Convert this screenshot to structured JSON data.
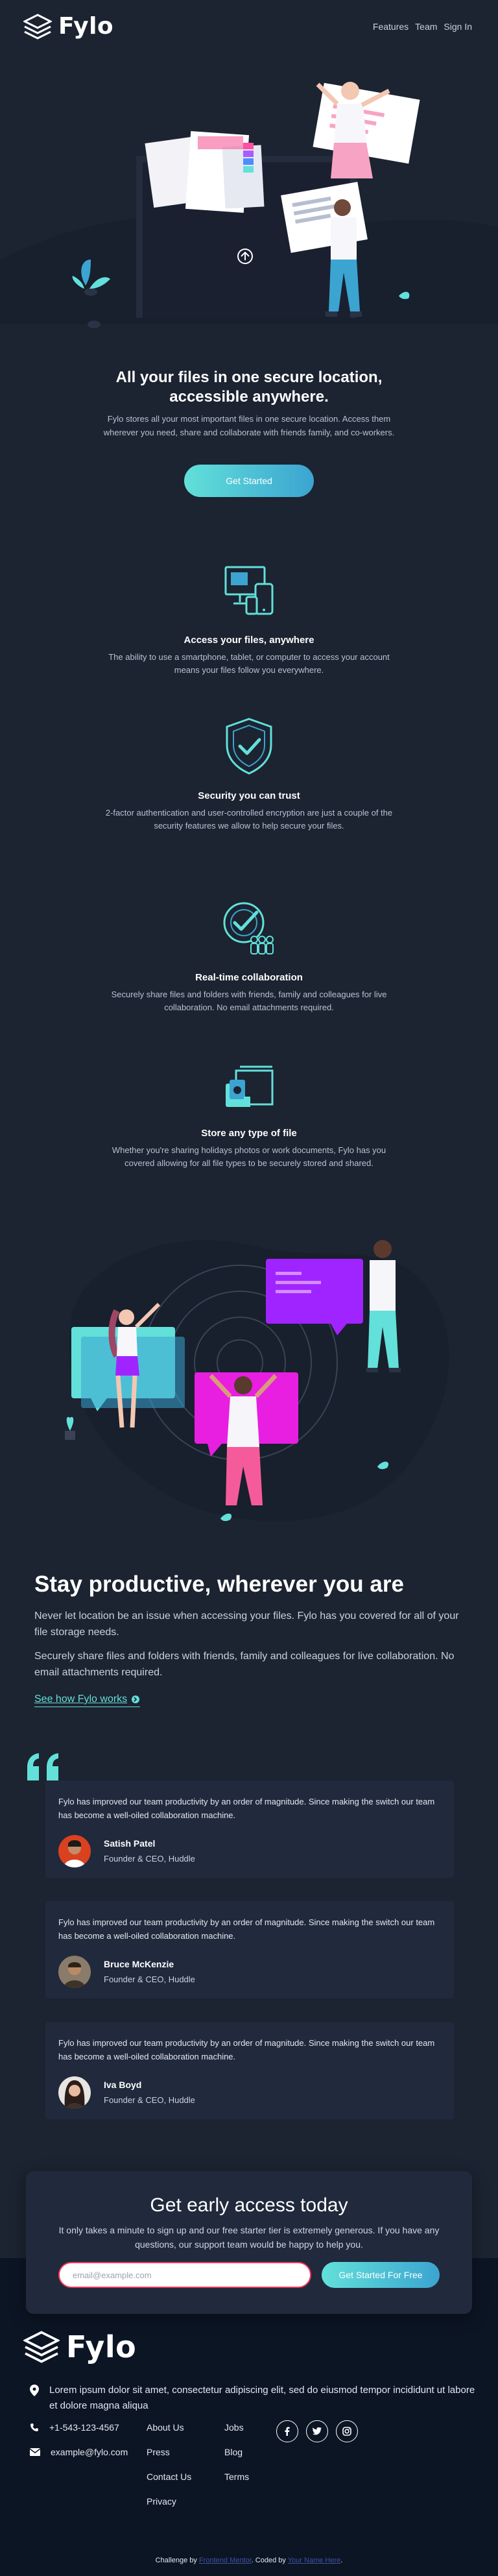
{
  "header": {
    "brand": "Fylo",
    "nav": [
      {
        "label": "Features"
      },
      {
        "label": "Team"
      },
      {
        "label": "Sign In"
      }
    ]
  },
  "hero": {
    "title": "All your files in one secure location, accessible anywhere.",
    "text": "Fylo stores all your most important files in one secure location. Access them wherever you need, share and collaborate with friends family, and co-workers.",
    "cta": "Get Started"
  },
  "features": [
    {
      "icon": "devices-icon",
      "title": "Access your files, anywhere",
      "text": "The ability to use a smartphone, tablet, or computer to access your account means your files follow you everywhere."
    },
    {
      "icon": "shield-check-icon",
      "title": "Security you can trust",
      "text": "2-factor authentication and user-controlled encryption are just a couple of the security features we allow to help secure your files."
    },
    {
      "icon": "collaboration-icon",
      "title": "Real-time collaboration",
      "text": "Securely share files and folders with friends, family and colleagues for live collaboration. No email attachments required."
    },
    {
      "icon": "folder-files-icon",
      "title": "Store any type of file",
      "text": "Whether you're sharing holidays photos or work documents, Fylo has you covered allowing for all file types to be securely stored and shared."
    }
  ],
  "productive": {
    "title": "Stay productive, wherever you are",
    "p1": "Never let location be an issue when accessing your files. Fylo has you covered for all of your file storage needs.",
    "p2": "Securely share files and folders with friends, family and colleagues for live collaboration. No email attachments required.",
    "link": "See how Fylo works"
  },
  "testimonials": [
    {
      "text": "Fylo has improved our team productivity by an order of magnitude. Since making the switch our team has become a well-oiled collaboration machine.",
      "name": "Satish Patel",
      "role": "Founder & CEO, Huddle"
    },
    {
      "text": "Fylo has improved our team productivity by an order of magnitude. Since making the switch our team has become a well-oiled collaboration machine.",
      "name": "Bruce McKenzie",
      "role": "Founder & CEO, Huddle"
    },
    {
      "text": "Fylo has improved our team productivity by an order of magnitude. Since making the switch our team has become a well-oiled collaboration machine.",
      "name": "Iva Boyd",
      "role": "Founder & CEO, Huddle"
    }
  ],
  "early_access": {
    "title": "Get early access today",
    "text": "It only takes a minute to sign up and our free starter tier is extremely generous. If you have any questions, our support team would be happy to help you.",
    "email_placeholder": "email@example.com",
    "cta": "Get Started For Free"
  },
  "footer": {
    "brand": "Fylo",
    "address": "Lorem ipsum dolor sit amet, consectetur adipiscing elit, sed do eiusmod tempor incididunt ut labore et dolore magna aliqua",
    "phone": "+1-543-123-4567",
    "email": "example@fylo.com",
    "col1": [
      "About Us",
      "Jobs",
      "Press",
      "Blog"
    ],
    "col2": [
      "Contact Us",
      "Terms",
      "Privacy"
    ],
    "attribution_prefix": "Challenge by",
    "attribution_link1": "Frontend Mentor",
    "attribution_mid": ". Coded by",
    "attribution_link2": "Your Name Here",
    "attribution_suffix": "."
  },
  "colors": {
    "background": "#1c2331",
    "card": "#21293c",
    "footer": "#0c1524",
    "accent_cyan": "#62e0d9",
    "accent_blue": "#3ba4d1",
    "error_red": "#f7395a"
  }
}
